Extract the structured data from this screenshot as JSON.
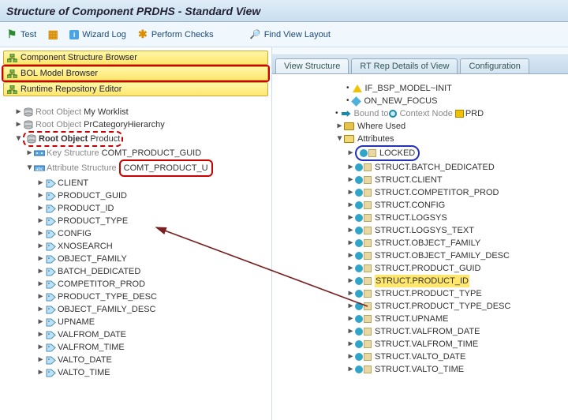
{
  "header": {
    "title": "Structure of Component PRDHS - Standard View"
  },
  "toolbar": {
    "test": "Test",
    "wizard_log": "Wizard Log",
    "perform_checks": "Perform Checks",
    "find_view_layout": "Find View Layout"
  },
  "nav": {
    "items": [
      {
        "label": "Component Structure Browser"
      },
      {
        "label": "BOL Model Browser",
        "highlight": true
      },
      {
        "label": "Runtime Repository Editor"
      }
    ]
  },
  "leftTree": {
    "root_label": "Root Object",
    "worklist": "My Worklist",
    "prcat": "PrCategoryHierarchy",
    "product": "Product",
    "key_struct_lbl": "Key Structure",
    "key_struct_val": "COMT_PRODUCT_GUID",
    "attr_struct_lbl": "Attribute Structure",
    "attr_struct_val": "COMT_PRODUCT_U",
    "attrs": [
      "CLIENT",
      "PRODUCT_GUID",
      "PRODUCT_ID",
      "PRODUCT_TYPE",
      "CONFIG",
      "XNOSEARCH",
      "OBJECT_FAMILY",
      "BATCH_DEDICATED",
      "COMPETITOR_PROD",
      "PRODUCT_TYPE_DESC",
      "OBJECT_FAMILY_DESC",
      "UPNAME",
      "VALFROM_DATE",
      "VALFROM_TIME",
      "VALTO_DATE",
      "VALTO_TIME"
    ]
  },
  "tabs": {
    "view_structure": "View Structure",
    "rt_rep": "RT Rep Details of View",
    "config": "Configuration"
  },
  "rightTree": {
    "if_init": "IF_BSP_MODEL~INIT",
    "on_new_focus": "ON_NEW_FOCUS",
    "bound_to_pre": "Bound to ",
    "context_node": "Context Node",
    "prd": "PRD",
    "where_used": "Where Used",
    "attributes": "Attributes",
    "locked": "LOCKED",
    "struct": [
      "STRUCT.BATCH_DEDICATED",
      "STRUCT.CLIENT",
      "STRUCT.COMPETITOR_PROD",
      "STRUCT.CONFIG",
      "STRUCT.LOGSYS",
      "STRUCT.LOGSYS_TEXT",
      "STRUCT.OBJECT_FAMILY",
      "STRUCT.OBJECT_FAMILY_DESC",
      "STRUCT.PRODUCT_GUID",
      "STRUCT.PRODUCT_ID",
      "STRUCT.PRODUCT_TYPE",
      "STRUCT.PRODUCT_TYPE_DESC",
      "STRUCT.UPNAME",
      "STRUCT.VALFROM_DATE",
      "STRUCT.VALFROM_TIME",
      "STRUCT.VALTO_DATE",
      "STRUCT.VALTO_TIME"
    ]
  }
}
